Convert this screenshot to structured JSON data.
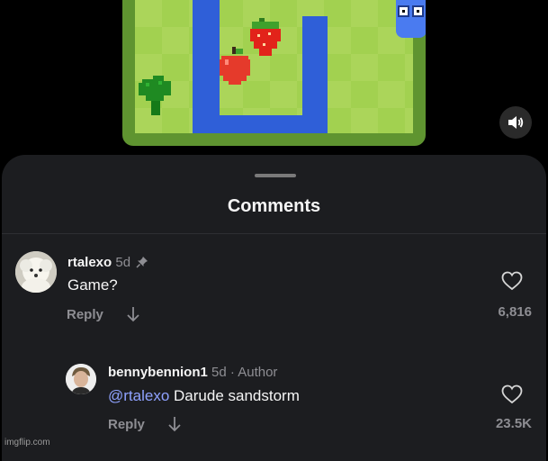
{
  "video": {
    "sound_icon": "speaker-icon"
  },
  "comments_sheet": {
    "title": "Comments"
  },
  "comments": [
    {
      "username": "rtalexo",
      "age": "5d",
      "pinned_icon": "pin-icon",
      "text": "Game?",
      "reply_label": "Reply",
      "likes": "6,816"
    },
    {
      "username": "bennybennion1",
      "age": "5d",
      "separator": "·",
      "badge": "Author",
      "mention": "@rtalexo",
      "text": "Darude sandstorm",
      "reply_label": "Reply",
      "likes": "23.5K"
    }
  ],
  "watermark": "imgflip.com"
}
